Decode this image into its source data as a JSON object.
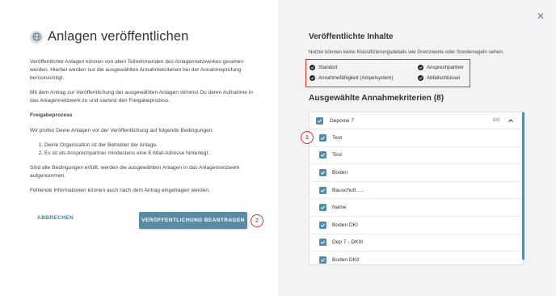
{
  "dialog": {
    "title": "Anlagen veröffentlichen",
    "paragraph1": "Veröffentlichte Anlagen können von allen Teilnehmenden des Anlagennetzwerkes gesehen werden. Hierbei werden nur die ausgewählten Annahmekriterien bei der Annahmeprüfung berücksichtigt.",
    "paragraph2": "Mit dem Antrag zur Veröffentlichung der ausgewählten Anlagen stimmst Du deren Aufnahme in das Anlagennetzwerk zu und startest den Freigabeprozess.",
    "process_heading": "Freigabeprozess",
    "conditions_intro": "Wir prüfen Deine Anlagen vor der Veröffentlichung auf folgende Bedingungen:",
    "conditions": [
      "Deine Organisation ist der Betreiber der Anlage.",
      "Es ist als Ansprechpartner mindestens eine E-Mail-Adresse hinterlegt."
    ],
    "paragraph3": "Sind alle Bedingungen erfüllt, werden die ausgewählten Anlagen in das Anlagennetzwerk aufgenommen.",
    "paragraph4": "Fehlende Informationen können auch nach dem Antrag eingetragen werden.",
    "cancel_label": "ABBRECHEN",
    "submit_label": "VERÖFFENTLICHUNG BEANTRAGEN"
  },
  "markers": {
    "one": "1",
    "two": "2"
  },
  "published": {
    "title": "Veröffentlichte Inhalte",
    "note": "Nutzer können keine Klassifizierungsdetails wie Grenzwerte oder Sonderregeln sehen.",
    "items": [
      "Standort",
      "Ansprechpartner",
      "Annahmefähigkeit (Ampelsystem)",
      "Abfallschlüssel"
    ]
  },
  "criteria": {
    "title": "Ausgewählte Annahmekriterien (8)",
    "group_label": "Deponie 7",
    "group_count": "8/8",
    "rows": [
      "Test",
      "Test",
      "Boden",
      "Bauschutt ....",
      "Name",
      "Boden DKI",
      "Dep 7 - DKIII",
      "Boden DKII"
    ]
  },
  "colors": {
    "accent": "#5b8aa3",
    "checkbox": "#4e8db2",
    "highlight": "#d9332b"
  },
  "icons": {
    "globe": "globe-icon",
    "close": "close-icon",
    "check": "check-circle-icon",
    "chevron": "chevron-up-icon"
  }
}
